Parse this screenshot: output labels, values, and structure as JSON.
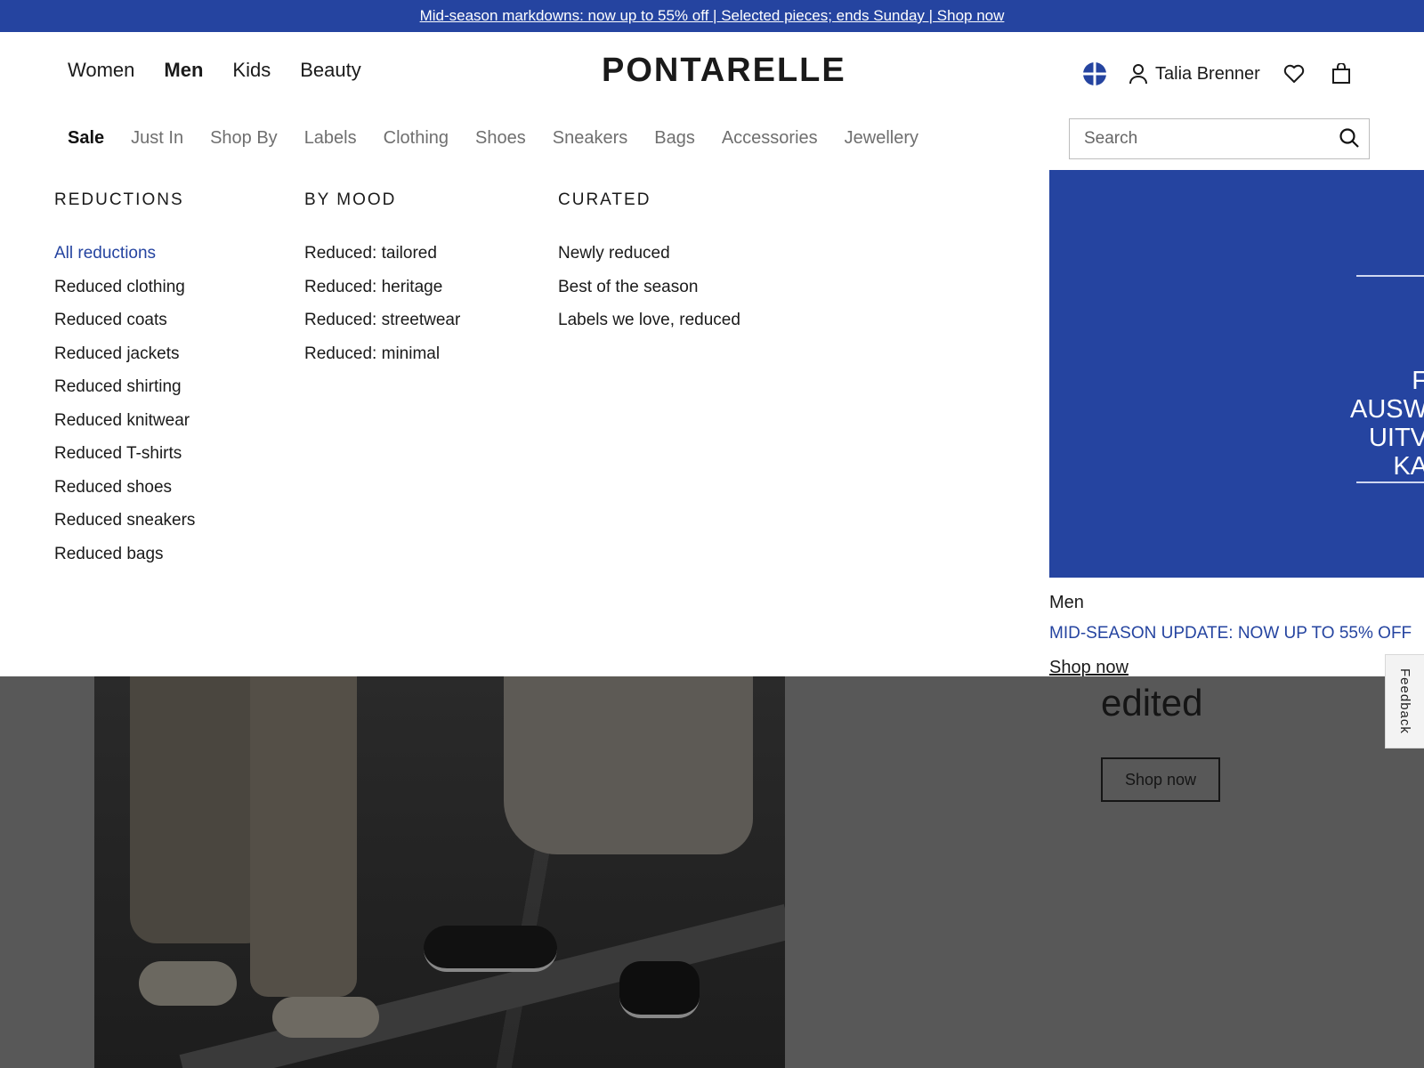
{
  "promo_bar": {
    "text": "Mid-season markdowns: now up to 55% off | Selected pieces; ends Sunday | Shop now"
  },
  "header": {
    "gender_nav": [
      {
        "label": "Women",
        "active": false
      },
      {
        "label": "Men",
        "active": true
      },
      {
        "label": "Kids",
        "active": false
      },
      {
        "label": "Beauty",
        "active": false
      }
    ],
    "logo": "PONTARELLE",
    "user_name": "Talia Brenner",
    "icons": [
      "globe-icon",
      "user-icon",
      "heart-icon",
      "bag-icon"
    ]
  },
  "category_nav": [
    {
      "label": "Sale",
      "active": true
    },
    {
      "label": "Just In",
      "active": false
    },
    {
      "label": "Shop By",
      "active": false
    },
    {
      "label": "Labels",
      "active": false
    },
    {
      "label": "Clothing",
      "active": false
    },
    {
      "label": "Shoes",
      "active": false
    },
    {
      "label": "Sneakers",
      "active": false
    },
    {
      "label": "Bags",
      "active": false
    },
    {
      "label": "Accessories",
      "active": false
    },
    {
      "label": "Jewellery",
      "active": false
    }
  ],
  "search": {
    "placeholder": "Search",
    "value": ""
  },
  "mega_menu": {
    "columns": [
      {
        "heading": "REDUCTIONS",
        "items": [
          {
            "label": "All reductions",
            "highlight": true
          },
          {
            "label": "Reduced clothing"
          },
          {
            "label": "Reduced coats"
          },
          {
            "label": "Reduced jackets"
          },
          {
            "label": "Reduced shirting"
          },
          {
            "label": "Reduced knitwear"
          },
          {
            "label": "Reduced T-shirts"
          },
          {
            "label": "Reduced shoes"
          },
          {
            "label": "Reduced sneakers"
          },
          {
            "label": "Reduced bags"
          }
        ]
      },
      {
        "heading": "BY MOOD",
        "items": [
          {
            "label": "Reduced: tailored"
          },
          {
            "label": "Reduced: heritage"
          },
          {
            "label": "Reduced: streetwear"
          },
          {
            "label": "Reduced: minimal"
          }
        ]
      },
      {
        "heading": "CURATED",
        "items": [
          {
            "label": "Newly reduced"
          },
          {
            "label": "Best of the season"
          },
          {
            "label": "Labels we love, reduced"
          }
        ]
      }
    ]
  },
  "promo_panel": {
    "lines": [
      "F",
      "AUSW",
      "UITV",
      "KA"
    ],
    "category": "Men",
    "headline": "MID-SEASON UPDATE: NOW UP TO 55% OFF",
    "link": "Shop now"
  },
  "background_page": {
    "headline_fragment": "edited",
    "button": "Shop now"
  },
  "feedback": {
    "label": "Feedback"
  },
  "colors": {
    "brand_blue": "#2544a0",
    "dim_background": "#585858"
  }
}
